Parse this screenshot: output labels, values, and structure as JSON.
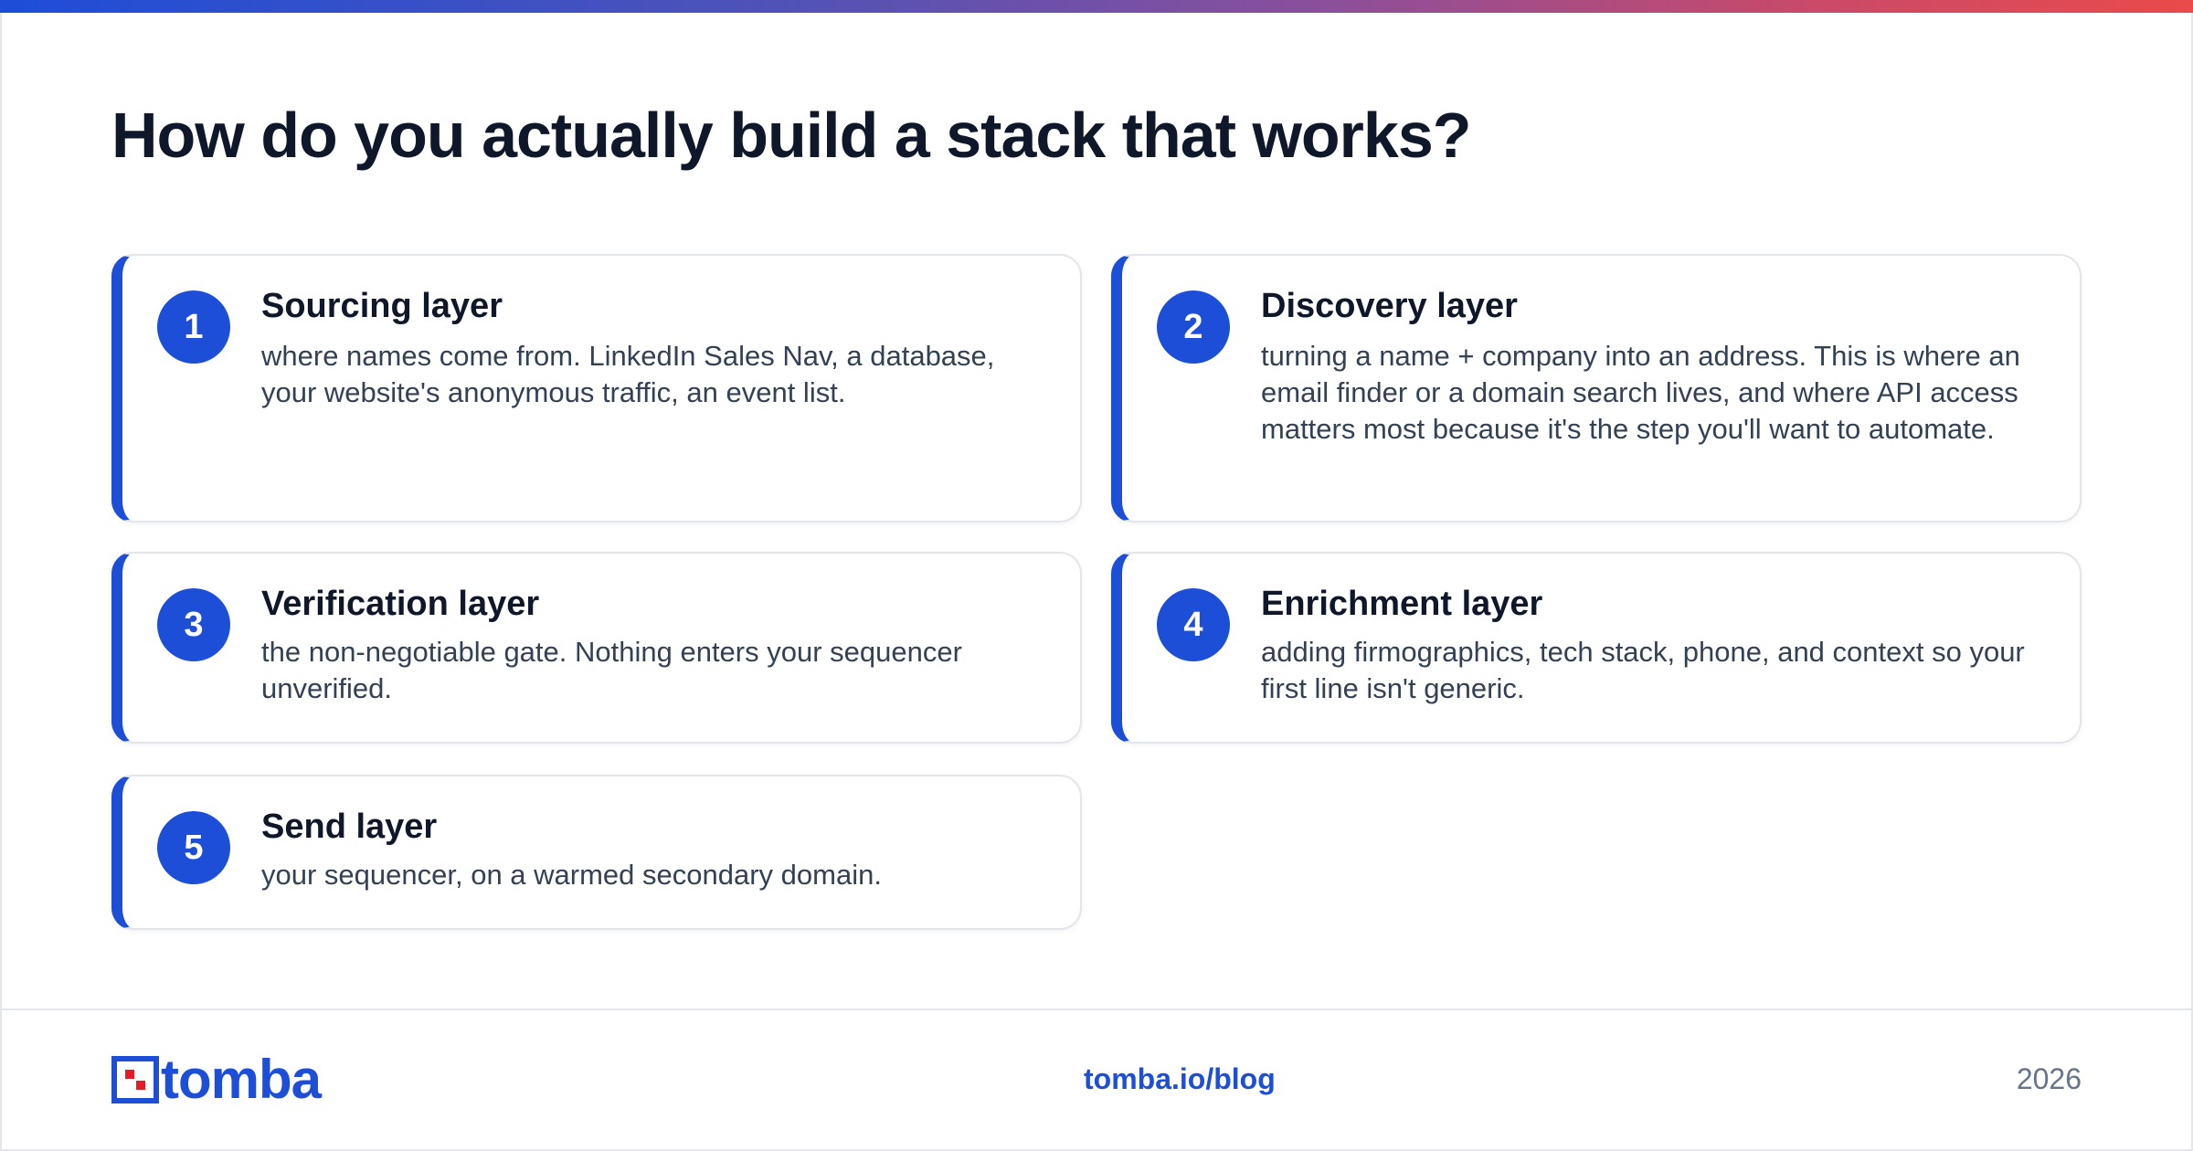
{
  "header": {
    "title": "How do you actually build a stack that works?"
  },
  "layers": [
    {
      "number": "1",
      "title": "Sourcing layer",
      "text": "where names come from. LinkedIn Sales Nav, a database, your website's anonymous traffic, an event list."
    },
    {
      "number": "2",
      "title": "Discovery layer",
      "text": "turning a name + company into an address. This is where an email finder or a domain search lives, and where API access matters most because it's the step you'll want to automate."
    },
    {
      "number": "3",
      "title": "Verification layer",
      "text": "the non-negotiable gate. Nothing enters your sequencer unverified."
    },
    {
      "number": "4",
      "title": "Enrichment layer",
      "text": "adding firmographics, tech stack, phone, and context so your first line isn't generic."
    },
    {
      "number": "5",
      "title": "Send layer",
      "text": "your sequencer, on a warmed secondary domain."
    }
  ],
  "footer": {
    "logo_text": "tomba",
    "link": "tomba.io/blog",
    "year": "2026"
  },
  "colors": {
    "accent": "#1d4ed8",
    "title": "#0f172a",
    "body_text": "#334155",
    "muted": "#64748b",
    "logo_red": "#e11d2a"
  }
}
